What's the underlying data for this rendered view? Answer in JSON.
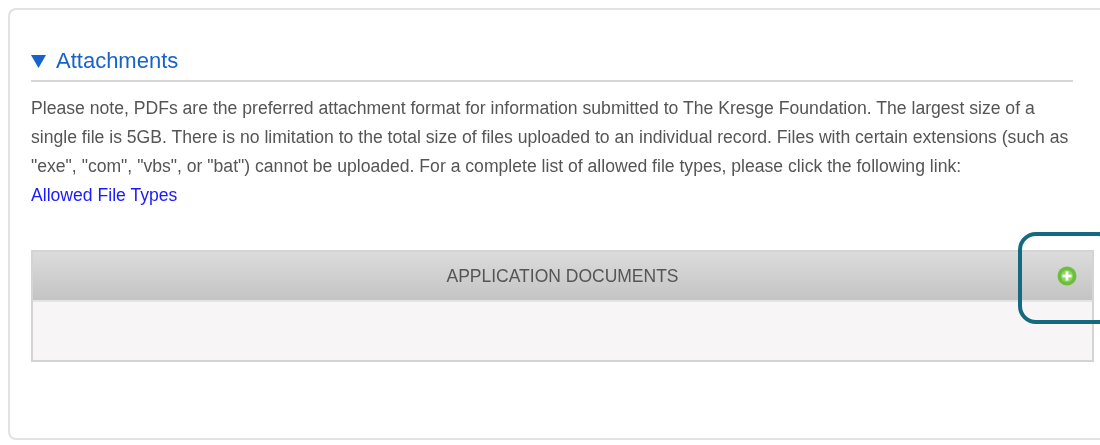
{
  "section": {
    "title": "Attachments",
    "expanded": true
  },
  "note": {
    "text": "Please note, PDFs are the preferred attachment format for information submitted to The Kresge Foundation. The largest size of a single file is 5GB. There is no limitation to the total size of files uploaded to an individual record. Files with certain extensions (such as \"exe\", \"com\", \"vbs\", or \"bat\") cannot be uploaded. For a complete list of allowed file types, please click the following link:",
    "link": "Allowed File Types"
  },
  "table": {
    "title": "APPLICATION DOCUMENTS",
    "highlighted_action": true
  }
}
